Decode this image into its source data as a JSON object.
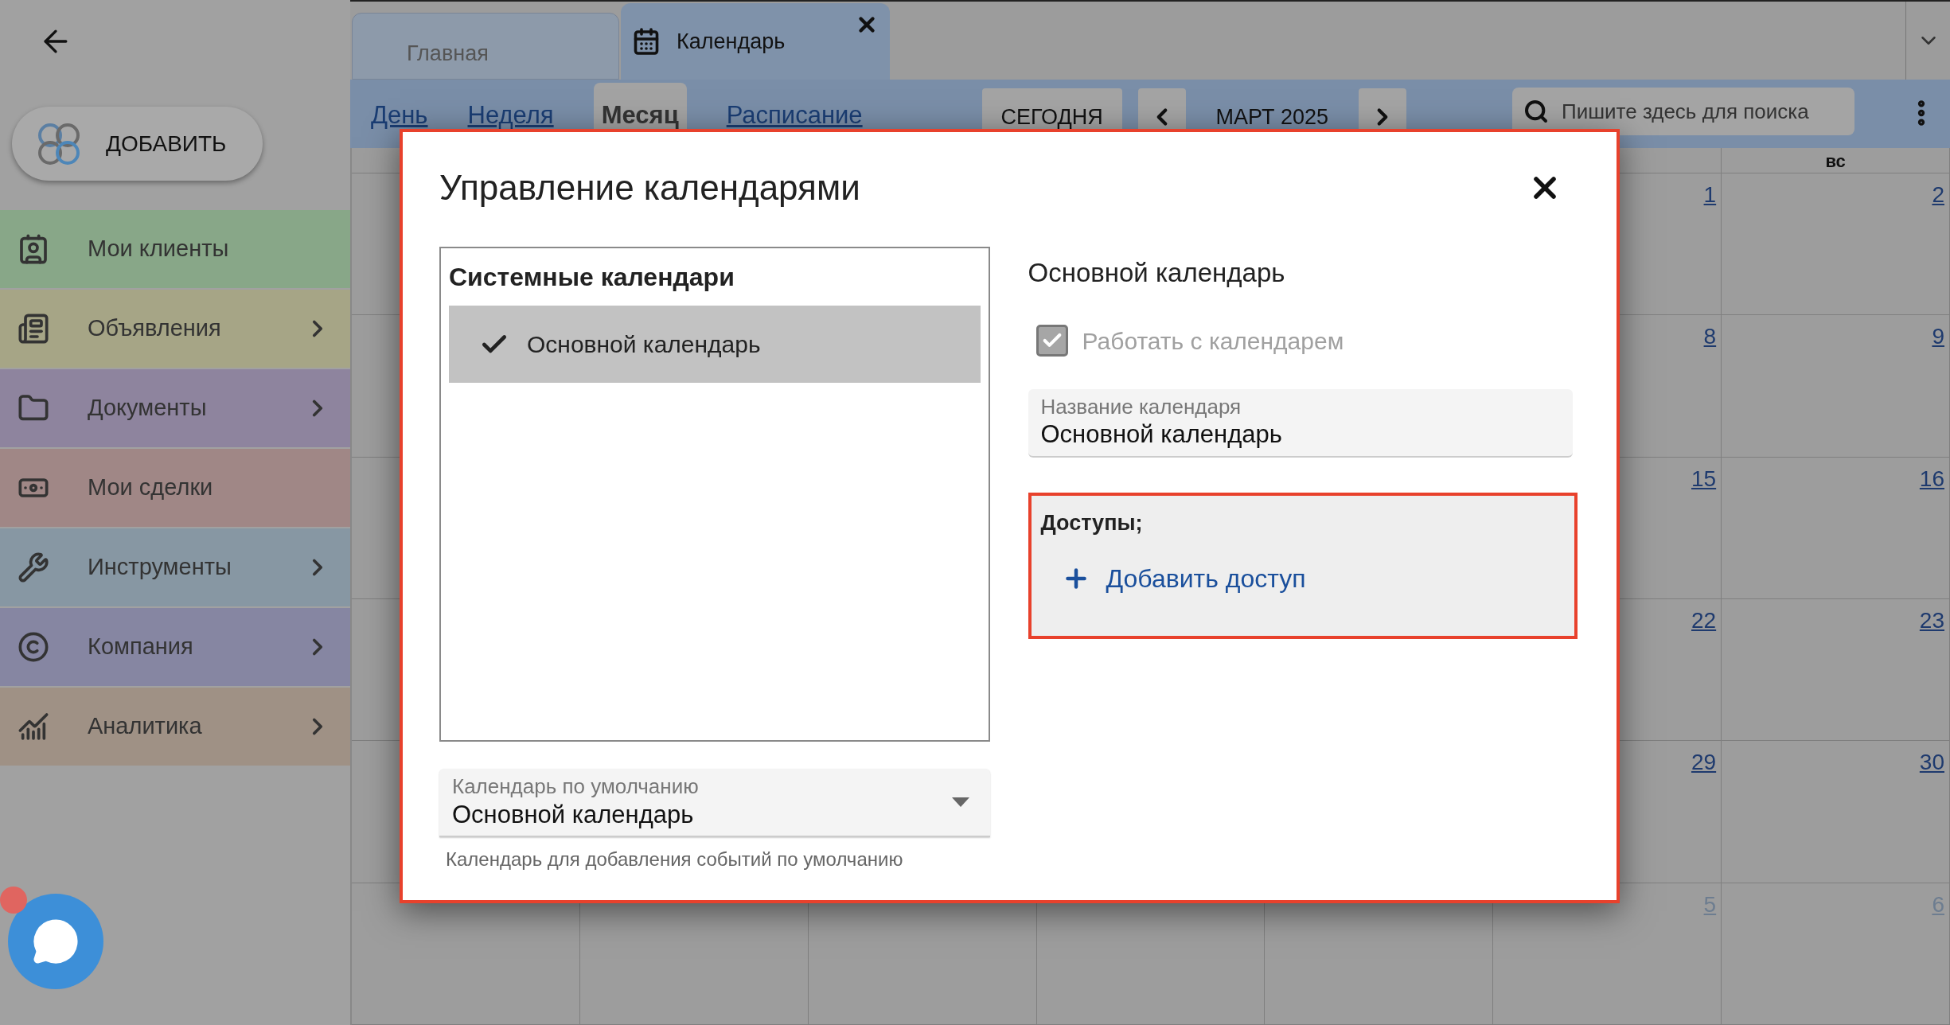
{
  "sidebar": {
    "add_button": "ДОБАВИТЬ",
    "items": [
      {
        "label": "Мои клиенты",
        "color": "#88a788",
        "expandable": false
      },
      {
        "label": "Объявления",
        "color": "#a6a586",
        "expandable": true
      },
      {
        "label": "Документы",
        "color": "#8e849e",
        "expandable": true
      },
      {
        "label": "Мои сделки",
        "color": "#a08786",
        "expandable": false
      },
      {
        "label": "Инструменты",
        "color": "#8797a3",
        "expandable": true
      },
      {
        "label": "Компания",
        "color": "#8686a2",
        "expandable": true
      },
      {
        "label": "Аналитика",
        "color": "#9f9185",
        "expandable": true
      }
    ]
  },
  "chat_button": {
    "unread": true
  },
  "tabs": [
    {
      "label": "Главная",
      "selected": false,
      "closable": false
    },
    {
      "label": "Календарь",
      "selected": true,
      "closable": true
    }
  ],
  "views": [
    {
      "label": "День",
      "selected": false
    },
    {
      "label": "Неделя",
      "selected": false
    },
    {
      "label": "Месяц",
      "selected": true
    },
    {
      "label": "Расписание",
      "selected": false
    }
  ],
  "today_button": "СЕГОДНЯ",
  "period": "МАРТ 2025",
  "search": {
    "placeholder": "Пишите здесь для поиска"
  },
  "calendar": {
    "header": {
      "column_7": "вс"
    },
    "rows": [
      {
        "column_6": "1",
        "column_7": "2",
        "outside_month": false
      },
      {
        "column_6": "8",
        "column_7": "9",
        "outside_month": false
      },
      {
        "column_6": "15",
        "column_7": "16",
        "outside_month": false
      },
      {
        "column_6": "22",
        "column_7": "23",
        "outside_month": false
      },
      {
        "column_6": "29",
        "column_7": "30",
        "outside_month": false
      },
      {
        "column_6": "5",
        "column_7": "6",
        "outside_month": true
      }
    ]
  },
  "dialog": {
    "title": "Управление календарями",
    "list": {
      "title": "Системные календари",
      "items": [
        {
          "label": "Основной календарь",
          "selected": true
        }
      ]
    },
    "default_select": {
      "label": "Календарь по умолчанию",
      "value": "Основной календарь",
      "helper": "Календарь для добавления событий по умолчанию"
    },
    "details": {
      "title": "Основной календарь",
      "checkbox": {
        "label": "Работать с календарем",
        "checked": true,
        "disabled": true
      },
      "name_field": {
        "label": "Название календаря",
        "value": "Основной календарь"
      },
      "access": {
        "title": "Доступы;",
        "add_link": "Добавить доступ"
      }
    }
  }
}
